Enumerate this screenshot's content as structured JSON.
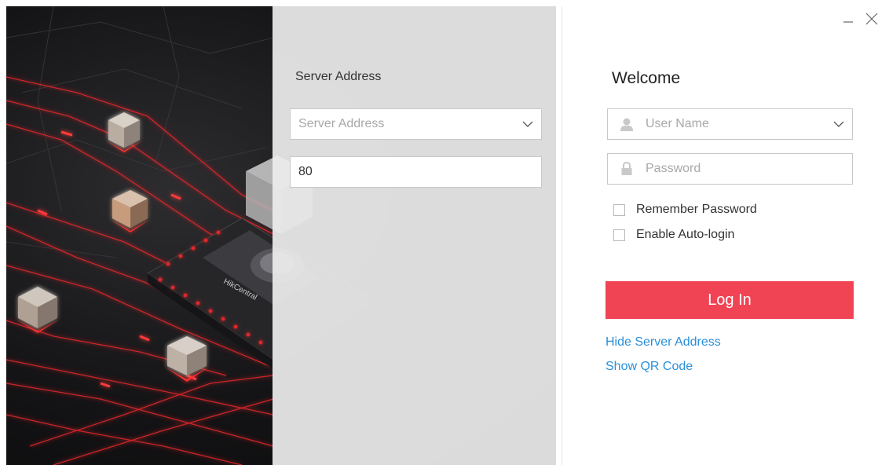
{
  "server_panel": {
    "title": "Server Address",
    "address_field": {
      "placeholder": "Server Address",
      "value": ""
    },
    "port_field": {
      "value": "80"
    }
  },
  "login_panel": {
    "title": "Welcome",
    "username_field": {
      "placeholder": "User Name",
      "icon": "user-icon"
    },
    "password_field": {
      "placeholder": "Password",
      "icon": "lock-icon"
    },
    "remember_password": {
      "label": "Remember Password",
      "checked": false
    },
    "auto_login": {
      "label": "Enable Auto-login",
      "checked": false
    },
    "login_button": {
      "label": "Log In"
    },
    "hide_server_link": "Hide Server Address",
    "qr_code_link": "Show QR Code"
  },
  "artwork": {
    "chip_label": "HikCentral"
  },
  "colors": {
    "accent": "#f04455",
    "link": "#2a8fd9",
    "circuit_red": "#e0262b"
  }
}
